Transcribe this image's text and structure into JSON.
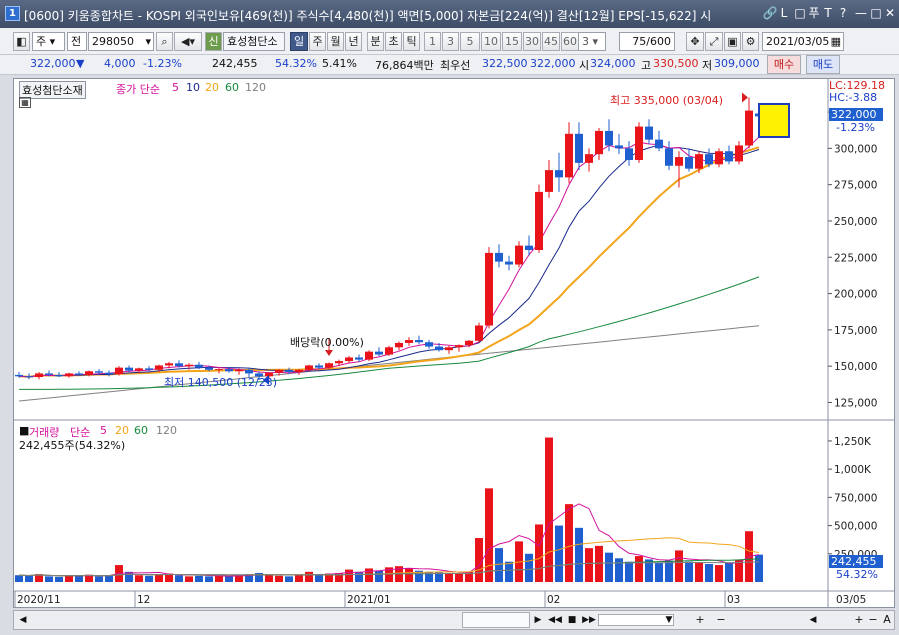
{
  "window": {
    "badge": "1",
    "title": "[0600] 키움종합차트 - KOSPI 외국인보유[469(천)] 주식수[4,480(천)] 액면[5,000] 자본금[224(억)] 결산[12월] EPS[-15,622] 시"
  },
  "titlebar_buttons": [
    "🔗",
    "L",
    "□",
    "푸",
    "T",
    "?",
    "—",
    "□",
    "✕"
  ],
  "toolbar": {
    "mode1": "주",
    "mode2": "전",
    "code": "298050",
    "badge_new": "신",
    "stock_name": "효성첨단소",
    "periods": [
      "일",
      "주",
      "월",
      "년",
      "분",
      "초",
      "틱"
    ],
    "active_period": "일",
    "numbers": [
      "1",
      "3",
      "5",
      "10",
      "15",
      "30",
      "45",
      "60"
    ],
    "count_select": "3",
    "count": "75",
    "count_max": "/600",
    "date": "2021/03/05"
  },
  "quote": {
    "price": "322,000",
    "arrow": "▼",
    "change": "4,000",
    "change_pct": "-1.23%",
    "volume": "242,455",
    "vol_ratio": "54.32%",
    "turnover": "5.41%",
    "amount": "76,864백만",
    "best_label": "최우선",
    "best_ask": "322,500",
    "best_bid": "322,000",
    "open_label": "시",
    "open": "324,000",
    "high_label": "고",
    "high": "330,500",
    "low_label": "저",
    "low": "309,000",
    "buy_label": "매수",
    "sell_label": "매도"
  },
  "price_legend": {
    "stock": "효성첨단소재",
    "close_label": "종가 단순",
    "ma5": "5",
    "ma10": "10",
    "ma20": "20",
    "ma60": "60",
    "ma120": "120"
  },
  "right_info": {
    "lc": "LC:129.18",
    "hc": "HC:-3.88",
    "price_tag": "322,000",
    "pct_tag": "-1.23%"
  },
  "annotations": {
    "high": "최고 335,000 (03/04)",
    "low": "최저 140,500 (12/23)",
    "dividend": "배당락(0.00%)"
  },
  "volume_legend": {
    "label": "거래량",
    "ma_label": "단순",
    "ma5": "5",
    "ma20": "20",
    "ma60": "60",
    "ma120": "120",
    "current": "242,455주(54.32%)",
    "tag_vol": "242,455",
    "tag_pct": "54.32%"
  },
  "price_axis": [
    "325,000",
    "300,000",
    "275,000",
    "250,000",
    "225,000",
    "200,000",
    "175,000",
    "150,000",
    "125,000"
  ],
  "volume_axis": [
    "1,250K",
    "1,000K",
    "750,000",
    "500,000",
    "250,000"
  ],
  "x_axis": [
    "2020/11",
    "12",
    "2021/01",
    "02",
    "03",
    "03/05"
  ],
  "colors": {
    "up": "#e8141a",
    "down": "#1f5fd0",
    "ma5": "#d4109c",
    "ma10": "#1c2a8c",
    "ma20": "#f2a51a",
    "ma60": "#178a3e",
    "ma120": "#808080"
  },
  "chart_data": {
    "type": "candlestick",
    "ylim_price": [
      115000,
      345000
    ],
    "ylim_volume": [
      0,
      1400000
    ],
    "candles": [
      [
        144000,
        146000,
        142000,
        143000
      ],
      [
        143000,
        145000,
        141000,
        142500
      ],
      [
        142500,
        146000,
        141000,
        145000
      ],
      [
        145000,
        147000,
        143000,
        144000
      ],
      [
        144000,
        146000,
        142500,
        143000
      ],
      [
        143000,
        145500,
        142000,
        145000
      ],
      [
        145000,
        146500,
        143500,
        144000
      ],
      [
        144000,
        147000,
        143000,
        146500
      ],
      [
        146500,
        148000,
        144500,
        145500
      ],
      [
        145500,
        147000,
        143000,
        144500
      ],
      [
        144500,
        150000,
        143500,
        149000
      ],
      [
        149000,
        150500,
        146000,
        147000
      ],
      [
        147000,
        149000,
        145000,
        148500
      ],
      [
        148500,
        150000,
        146500,
        147500
      ],
      [
        147500,
        151000,
        146000,
        150500
      ],
      [
        150500,
        153000,
        148500,
        152000
      ],
      [
        152000,
        154000,
        149000,
        150000
      ],
      [
        150000,
        152000,
        147500,
        151000
      ],
      [
        151000,
        153000,
        148000,
        149000
      ],
      [
        149000,
        150500,
        146500,
        147500
      ],
      [
        147500,
        149000,
        145000,
        148000
      ],
      [
        148000,
        149500,
        145500,
        146500
      ],
      [
        146500,
        148500,
        144000,
        147500
      ],
      [
        147500,
        149000,
        142000,
        145000
      ],
      [
        145000,
        146500,
        140500,
        143000
      ],
      [
        143000,
        146000,
        141000,
        145500
      ],
      [
        145500,
        148000,
        143500,
        147500
      ],
      [
        147500,
        149000,
        144500,
        146000
      ],
      [
        146000,
        148000,
        144000,
        147500
      ],
      [
        147500,
        151000,
        146500,
        150500
      ],
      [
        150500,
        152000,
        148000,
        149000
      ],
      [
        149000,
        152500,
        148000,
        152000
      ],
      [
        152000,
        154500,
        150000,
        153500
      ],
      [
        153500,
        157000,
        152000,
        156000
      ],
      [
        156000,
        158000,
        153000,
        154500
      ],
      [
        154500,
        161000,
        153500,
        160000
      ],
      [
        160000,
        163000,
        157000,
        158000
      ],
      [
        158000,
        164000,
        157000,
        163000
      ],
      [
        163000,
        167000,
        161000,
        166000
      ],
      [
        166000,
        170000,
        164000,
        168000
      ],
      [
        168000,
        171000,
        165000,
        166500
      ],
      [
        166500,
        168000,
        162000,
        163500
      ],
      [
        163500,
        166000,
        160000,
        161000
      ],
      [
        161000,
        164000,
        158500,
        163000
      ],
      [
        163000,
        165000,
        160000,
        164500
      ],
      [
        164500,
        168000,
        163000,
        167500
      ],
      [
        167500,
        180000,
        166500,
        178000
      ],
      [
        178000,
        232000,
        176000,
        228000
      ],
      [
        228000,
        234000,
        218000,
        222000
      ],
      [
        222000,
        226000,
        216000,
        220000
      ],
      [
        220000,
        236000,
        218000,
        233000
      ],
      [
        233000,
        240000,
        226000,
        230000
      ],
      [
        230000,
        275000,
        228000,
        270000
      ],
      [
        270000,
        292000,
        266000,
        285000
      ],
      [
        285000,
        297000,
        270000,
        280000
      ],
      [
        280000,
        318000,
        276000,
        310000
      ],
      [
        310000,
        318000,
        285000,
        290000
      ],
      [
        290000,
        300000,
        284000,
        296000
      ],
      [
        296000,
        314000,
        292000,
        312000
      ],
      [
        312000,
        320000,
        298000,
        302000
      ],
      [
        302000,
        310000,
        296000,
        300000
      ],
      [
        300000,
        305000,
        288000,
        292000
      ],
      [
        292000,
        318000,
        290000,
        315000
      ],
      [
        315000,
        320000,
        303000,
        306000
      ],
      [
        306000,
        312000,
        298000,
        300000
      ],
      [
        300000,
        305000,
        285000,
        288000
      ],
      [
        288000,
        298000,
        273000,
        294000
      ],
      [
        294000,
        300000,
        284000,
        286000
      ],
      [
        286000,
        298000,
        283000,
        296000
      ],
      [
        296000,
        300000,
        287000,
        289000
      ],
      [
        289000,
        300000,
        287000,
        298000
      ],
      [
        298000,
        302000,
        289000,
        291000
      ],
      [
        291000,
        305000,
        289000,
        302000
      ],
      [
        302000,
        335000,
        300000,
        326000
      ],
      [
        324000,
        330500,
        309000,
        322000
      ]
    ],
    "volumes": [
      60000,
      55000,
      70000,
      50000,
      45000,
      60000,
      55000,
      65000,
      50000,
      55000,
      150000,
      90000,
      60000,
      55000,
      70000,
      75000,
      60000,
      50000,
      55000,
      50000,
      55000,
      50000,
      60000,
      70000,
      80000,
      60000,
      55000,
      50000,
      60000,
      90000,
      70000,
      75000,
      80000,
      110000,
      90000,
      120000,
      100000,
      130000,
      140000,
      120000,
      100000,
      90000,
      85000,
      80000,
      75000,
      90000,
      390000,
      830000,
      300000,
      180000,
      360000,
      250000,
      510000,
      1280000,
      500000,
      690000,
      480000,
      300000,
      320000,
      260000,
      210000,
      180000,
      230000,
      200000,
      170000,
      190000,
      280000,
      180000,
      170000,
      160000,
      150000,
      170000,
      200000,
      450000,
      242455
    ]
  }
}
